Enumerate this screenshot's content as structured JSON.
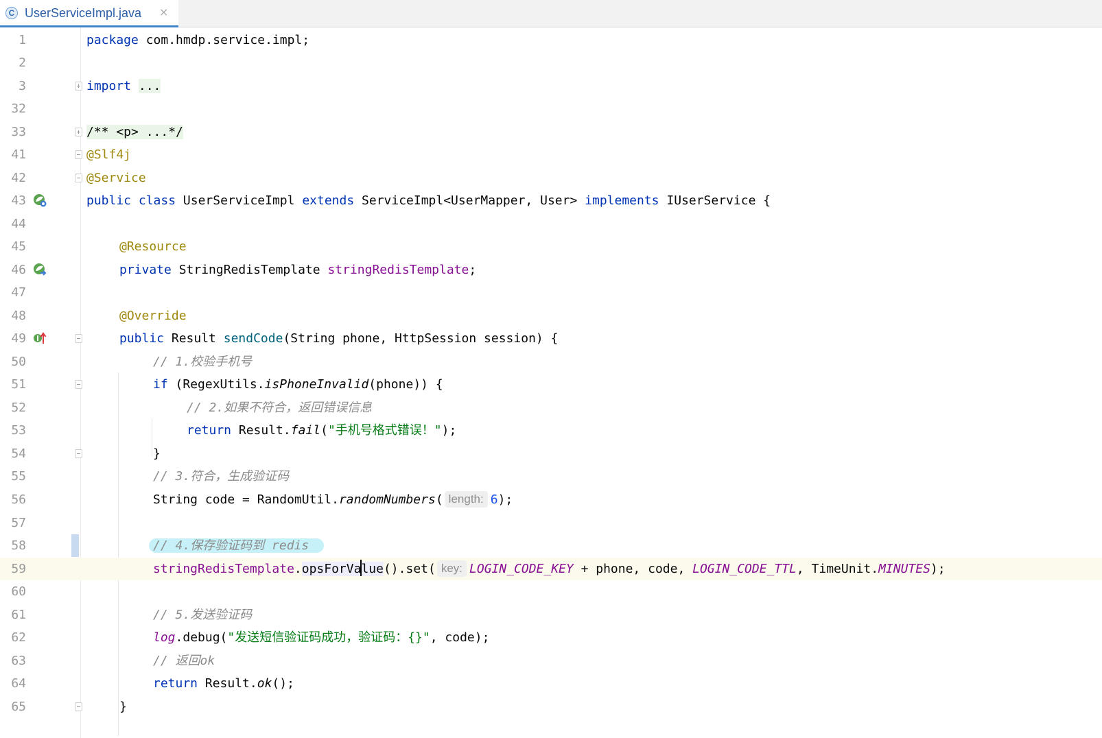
{
  "tab": {
    "icon_letter": "C",
    "label": "UserServiceImpl.java",
    "close": "×"
  },
  "lines": [
    {
      "n": "1"
    },
    {
      "n": "2"
    },
    {
      "n": "3"
    },
    {
      "n": "32"
    },
    {
      "n": "33"
    },
    {
      "n": "41"
    },
    {
      "n": "42"
    },
    {
      "n": "43"
    },
    {
      "n": "44"
    },
    {
      "n": "45"
    },
    {
      "n": "46"
    },
    {
      "n": "47"
    },
    {
      "n": "48"
    },
    {
      "n": "49"
    },
    {
      "n": "50"
    },
    {
      "n": "51"
    },
    {
      "n": "52"
    },
    {
      "n": "53"
    },
    {
      "n": "54"
    },
    {
      "n": "55"
    },
    {
      "n": "56"
    },
    {
      "n": "57"
    },
    {
      "n": "58"
    },
    {
      "n": "59"
    },
    {
      "n": "60"
    },
    {
      "n": "61"
    },
    {
      "n": "62"
    },
    {
      "n": "63"
    },
    {
      "n": "64"
    },
    {
      "n": "65"
    }
  ],
  "code": {
    "package_kw": "package",
    "package_name": " com.hmdp.service.impl;",
    "import_kw": "import",
    "import_folded": "...",
    "javadoc_folded": "/** <p> ...*/",
    "ann_slf4j": "@Slf4j",
    "ann_service": "@Service",
    "public": "public",
    "class": "class",
    "class_name": "UserServiceImpl",
    "extends": "extends",
    "super_type": "ServiceImpl<UserMapper, User>",
    "implements": "implements",
    "iface": "IUserService {",
    "ann_resource": "@Resource",
    "private": "private",
    "field_type": "StringRedisTemplate",
    "field_name": "stringRedisTemplate",
    "semi": ";",
    "ann_override": "@Override",
    "ret_type": "Result",
    "method_name": "sendCode",
    "params": "(String phone, HttpSession session) {",
    "c1": "// 1.校验手机号",
    "if": "if",
    "if_open": "(RegexUtils.",
    "is_phone_invalid": "isPhoneInvalid",
    "if_close": "(phone)) {",
    "c2": "// 2.如果不符合，返回错误信息",
    "return": "return",
    "result_dot": "Result.",
    "fail": "fail",
    "paren_open": "(",
    "fail_msg": "\"手机号格式错误！\"",
    "paren_close_semi": ");",
    "brace_close": "}",
    "c3": "// 3.符合，生成验证码",
    "code_decl": "String code = RandomUtil.",
    "random_numbers": "randomNumbers",
    "hint_length": "length:",
    "six": "6",
    "c4": "// 4.保存验证码到 redis",
    "srt": "stringRedisTemplate",
    "dot": ".",
    "ops_a": "opsForVa",
    "ops_b": "lue",
    "set_call": "().set(",
    "hint_key": "key:",
    "login_code_key": "LOGIN_CODE_KEY",
    "plus_phone": " + phone, code, ",
    "login_code_ttl": "LOGIN_CODE_TTL",
    "comma_tu": ", TimeUnit.",
    "minutes": "MINUTES",
    "c5": "// 5.发送验证码",
    "log": "log",
    "debug_open": ".debug(",
    "debug_msg": "\"发送短信验证码成功，验证码：{}\"",
    "debug_close": ", code);",
    "c6": "// 返回ok",
    "result_ok_pre": "Result.",
    "ok": "ok",
    "ok_close": "();",
    "method_close": "}"
  },
  "colors": {
    "keyword": "#0033b3",
    "annotation": "#9e880d",
    "field": "#871094",
    "method": "#00627a",
    "string": "#067d17",
    "number": "#1750eb",
    "comment": "#8c8c8c",
    "current_line": "#fcfaed"
  }
}
